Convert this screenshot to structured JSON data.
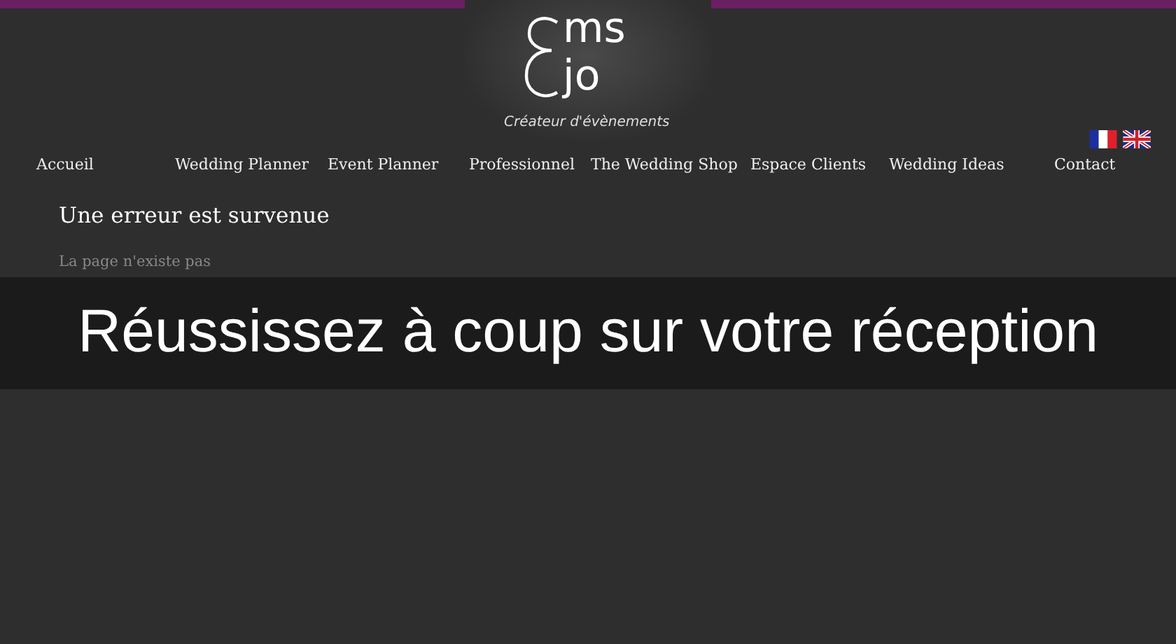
{
  "logo": {
    "line_1": "ms",
    "line_2": "jo",
    "tagline": "Créateur d'évènements"
  },
  "nav": [
    "Accueil",
    "Wedding Planner",
    "Event Planner",
    "Professionnel",
    "The Wedding Shop",
    "Espace Clients",
    "Wedding Ideas",
    "Contact"
  ],
  "error": {
    "title": "Une erreur est survenue",
    "message": "La page n'existe pas"
  },
  "banner": {
    "text": "Réussissez à coup sur votre réception"
  }
}
